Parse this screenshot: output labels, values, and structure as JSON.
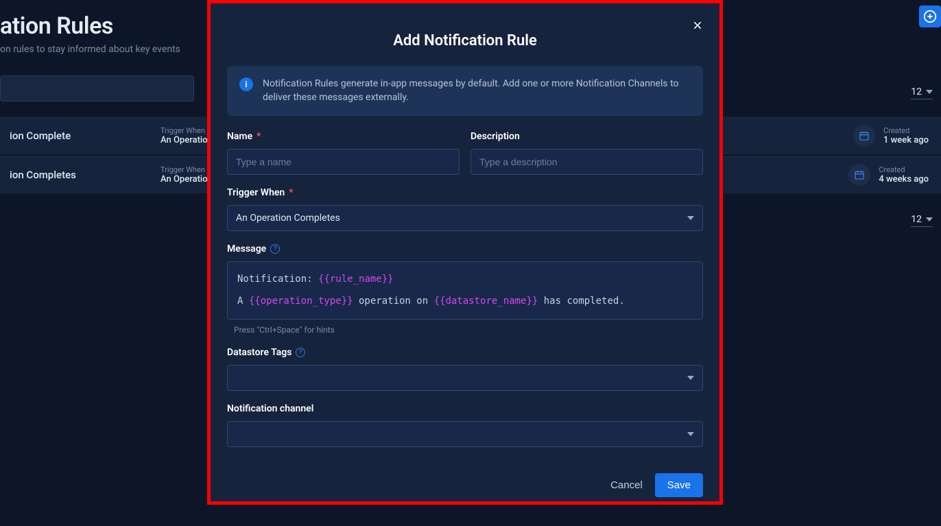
{
  "page": {
    "title_fragment": "ation Rules",
    "subtitle_fragment": "on rules to stay informed about key events",
    "page_size": "12"
  },
  "rows": [
    {
      "title_fragment": "ion Complete",
      "trigger_label": "Trigger When",
      "trigger_value": "An Operation",
      "created_label": "Created",
      "created_value": "1 week ago"
    },
    {
      "title_fragment": "ion Completes",
      "trigger_label": "Trigger When",
      "trigger_value": "An Operation",
      "created_label": "Created",
      "created_value": "4 weeks ago"
    }
  ],
  "modal": {
    "title": "Add Notification Rule",
    "info": "Notification Rules generate in-app messages by default. Add one or more Notification Channels to deliver these messages externally.",
    "fields": {
      "name_label": "Name",
      "name_placeholder": "Type a name",
      "desc_label": "Description",
      "desc_placeholder": "Type a description",
      "trigger_label": "Trigger When",
      "trigger_value": "An Operation Completes",
      "message_label": "Message",
      "message_prefix": "Notification: ",
      "message_tmpl1": "{{rule_name}}",
      "message_line2_a": "A ",
      "message_tmpl2": "{{operation_type}}",
      "message_line2_b": " operation on ",
      "message_tmpl3": "{{datastore_name}}",
      "message_line2_c": " has completed.",
      "message_hint": "Press \"Ctrl+Space\" for hints",
      "tags_label": "Datastore Tags",
      "channel_label": "Notification channel"
    },
    "buttons": {
      "cancel": "Cancel",
      "save": "Save"
    }
  }
}
